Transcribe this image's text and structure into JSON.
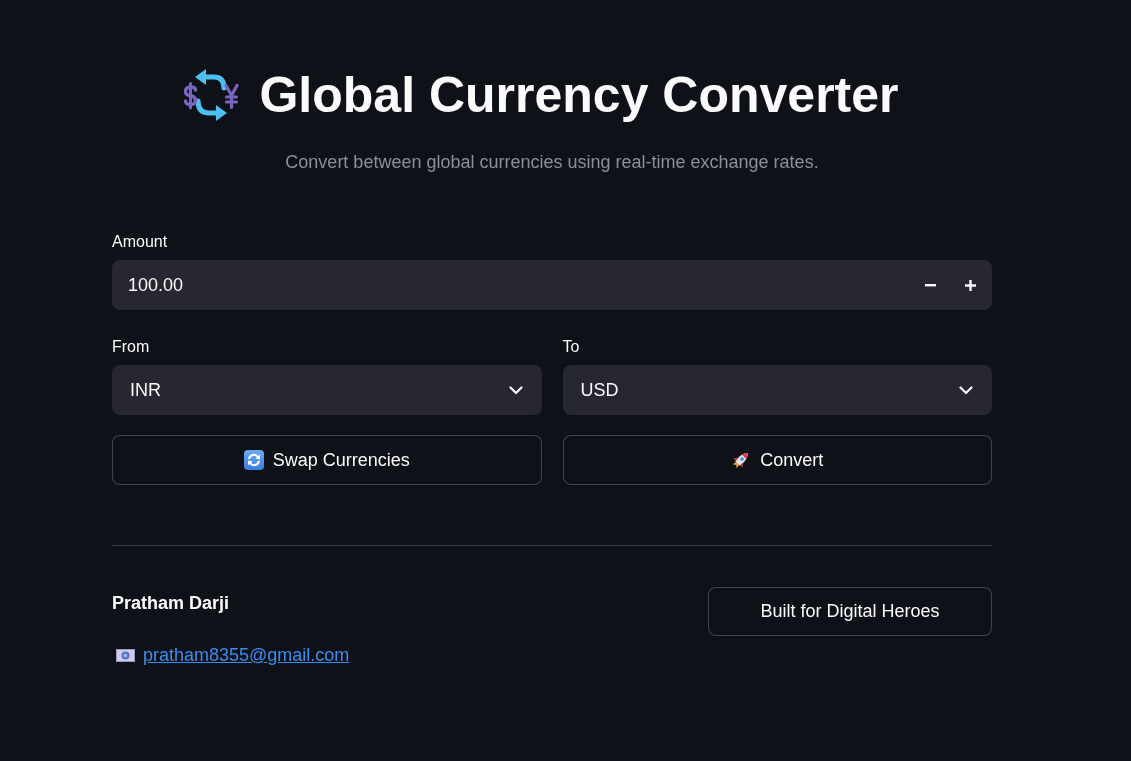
{
  "header": {
    "title": "Global Currency Converter",
    "subtitle": "Convert between global currencies using real-time exchange rates."
  },
  "amount": {
    "label": "Amount",
    "value": "100.00"
  },
  "currency_selects": [
    {
      "label": "From",
      "value": "INR"
    },
    {
      "label": "To",
      "value": "USD"
    }
  ],
  "actions": [
    {
      "kind": "swap",
      "label": "Swap Currencies"
    },
    {
      "kind": "convert",
      "label": "Convert"
    }
  ],
  "footer": {
    "author": "Pratham Darji",
    "email": "pratham8355@gmail.com",
    "credit_button": "Built for Digital Heroes"
  }
}
